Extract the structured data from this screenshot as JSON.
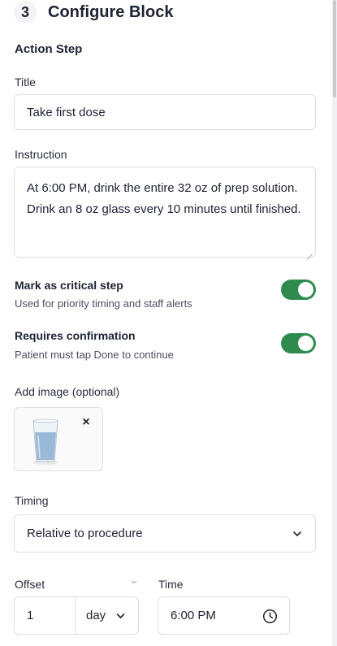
{
  "header": {
    "step_number": "3",
    "title": "Configure Block"
  },
  "section": {
    "label": "Action Step"
  },
  "title_field": {
    "label": "Title",
    "value": "Take first dose"
  },
  "instruction_field": {
    "label": "Instruction",
    "value": "At 6:00 PM, drink the entire 32 oz of prep solution. Drink an 8 oz glass every 10 minutes until finished."
  },
  "critical_toggle": {
    "label": "Mark as critical step",
    "subtitle": "Used for priority timing and staff alerts",
    "on": true
  },
  "confirmation_toggle": {
    "label": "Requires confirmation",
    "subtitle": "Patient must tap Done to continue",
    "on": true
  },
  "image_field": {
    "label": "Add image (optional)",
    "remove_label": "×",
    "icon": "water-glass-image"
  },
  "timing_field": {
    "label": "Timing",
    "selected": "Relative to procedure"
  },
  "offset_field": {
    "label": "Offset",
    "value": "1",
    "unit": "day"
  },
  "time_field": {
    "label": "Time",
    "value": "6:00 PM"
  },
  "colors": {
    "toggle_on": "#2f8a4e",
    "border": "#dcdde3",
    "text": "#1f2233"
  }
}
